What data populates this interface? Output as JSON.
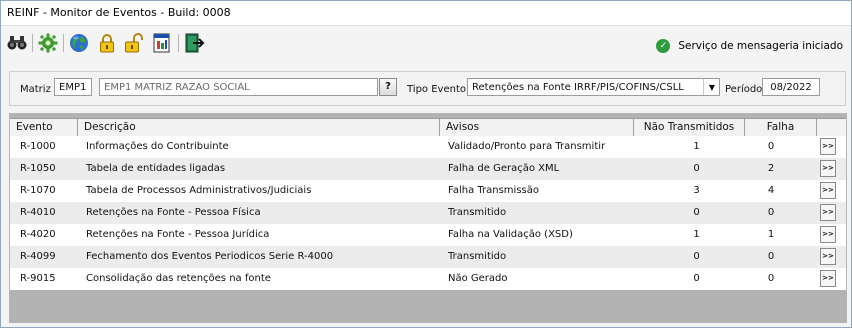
{
  "window": {
    "title": "REINF - Monitor de Eventos - Build: 0008"
  },
  "toolbar": {
    "icons": [
      "binoculars-icon",
      "puzzle-icon",
      "globe-icon",
      "padlock-locked-icon",
      "padlock-unlocked-icon",
      "report-icon",
      "exit-icon"
    ],
    "status_text": "Serviço de mensageria iniciado"
  },
  "filter": {
    "matriz_label": "Matriz",
    "matriz_code": "EMP1",
    "matriz_name": "EMP1 MATRIZ RAZAO SOCIAL",
    "lookup_label": "?",
    "tipo_evento_label": "Tipo Evento",
    "tipo_evento_value": "Retenções na Fonte IRRF/PIS/COFINS/CSLL",
    "periodo_label": "Período",
    "periodo_value": "08/2022"
  },
  "grid": {
    "headers": [
      "Evento",
      "Descrição",
      "Avisos",
      "Não Transmitidos",
      "Falha"
    ],
    "row_button_label": ">>",
    "rows": [
      {
        "evento": "R-1000",
        "descricao": "Informações do Contribuinte",
        "avisos": "Validado/Pronto para Transmitir",
        "nao_transmitidos": "1",
        "falha": "0"
      },
      {
        "evento": "R-1050",
        "descricao": "Tabela de entidades ligadas",
        "avisos": "Falha de Geração XML",
        "nao_transmitidos": "0",
        "falha": "2"
      },
      {
        "evento": "R-1070",
        "descricao": "Tabela de Processos Administrativos/Judiciais",
        "avisos": "Falha Transmissão",
        "nao_transmitidos": "3",
        "falha": "4"
      },
      {
        "evento": "R-4010",
        "descricao": "Retenções na Fonte - Pessoa Física",
        "avisos": "Transmitido",
        "nao_transmitidos": "0",
        "falha": "0"
      },
      {
        "evento": "R-4020",
        "descricao": "Retenções na Fonte - Pessoa Jurídica",
        "avisos": "Falha na Validação (XSD)",
        "nao_transmitidos": "1",
        "falha": "1"
      },
      {
        "evento": "R-4099",
        "descricao": "Fechamento dos Eventos Periodicos Serie R-4000",
        "avisos": "Transmitido",
        "nao_transmitidos": "0",
        "falha": "0"
      },
      {
        "evento": "R-9015",
        "descricao": "Consolidação das retenções na fonte",
        "avisos": "Não Gerado",
        "nao_transmitidos": "0",
        "falha": "0"
      }
    ]
  },
  "colors": {
    "status_ok": "#2e9b3f",
    "grid_background": "#b3b3b3",
    "window_border": "#8fa7c2"
  }
}
